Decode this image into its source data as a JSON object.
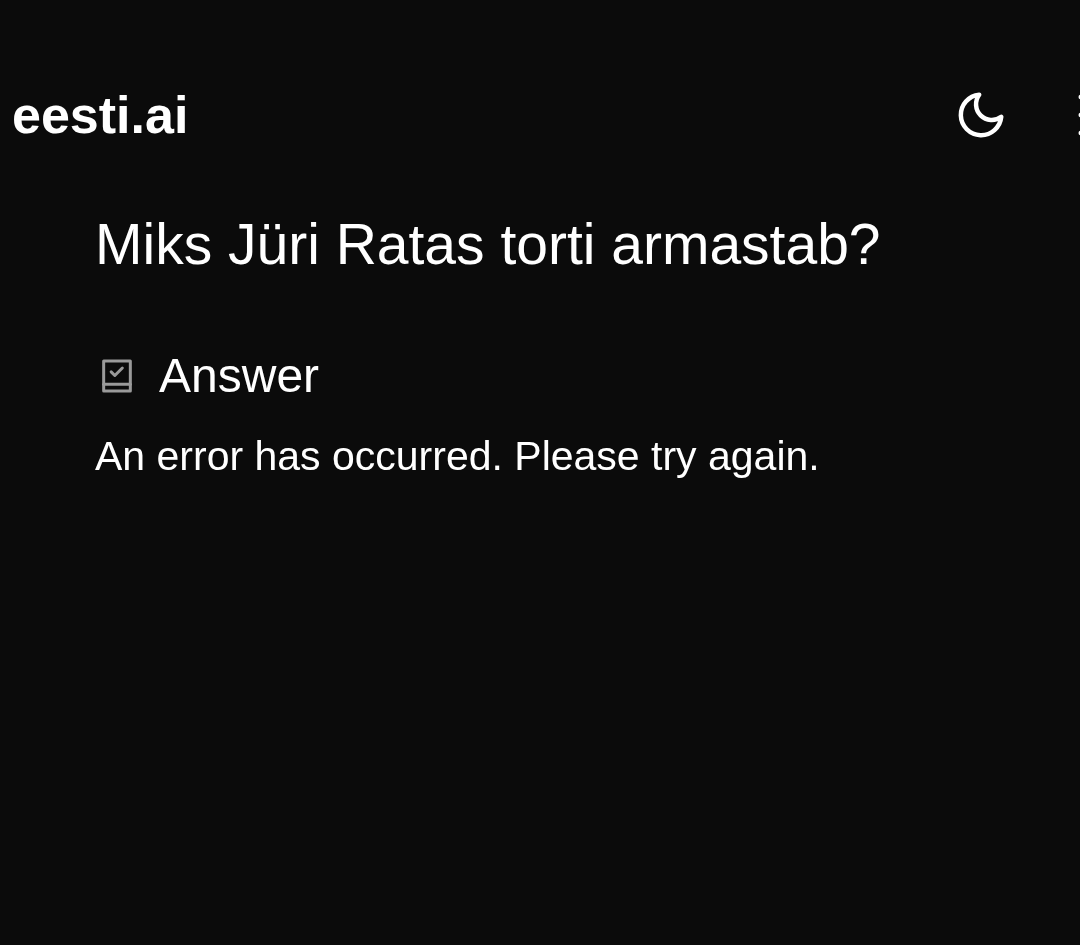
{
  "header": {
    "logo": "eesti.ai"
  },
  "question": "Miks Jüri Ratas torti armastab?",
  "answer": {
    "heading": "Answer",
    "text": "An error has occurred. Please try again."
  }
}
